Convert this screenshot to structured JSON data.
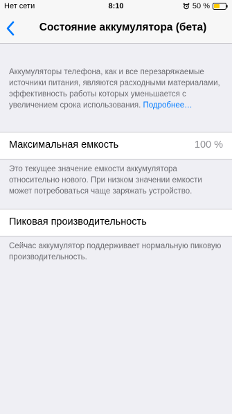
{
  "status_bar": {
    "carrier": "Нет сети",
    "time": "8:10",
    "battery_percent": "50 %",
    "battery_level": 0.5,
    "icons": [
      "alarm-icon",
      "battery-icon"
    ]
  },
  "nav": {
    "back_icon": "chevron-left-icon",
    "title": "Состояние аккумулятора (бета)"
  },
  "intro": {
    "text": "Аккумуляторы телефона, как и все перезаряжаемые источники питания, являются расходными материалами, эффективность работы которых уменьшается с увеличением срока использования.",
    "link": "Подробнее…"
  },
  "max_capacity": {
    "label": "Максимальная емкость",
    "value": "100 %",
    "footnote": "Это текущее значение емкости аккумулятора относительно нового. При низком значении емкости может потребоваться чаще заряжать устройство."
  },
  "peak_performance": {
    "label": "Пиковая производительность",
    "footnote": "Сейчас аккумулятор поддерживает нормальную пиковую производительность."
  },
  "colors": {
    "accent": "#007aff",
    "background": "#efeff4",
    "secondary_text": "#6d6d72",
    "battery_fill": "#ffcc00"
  }
}
